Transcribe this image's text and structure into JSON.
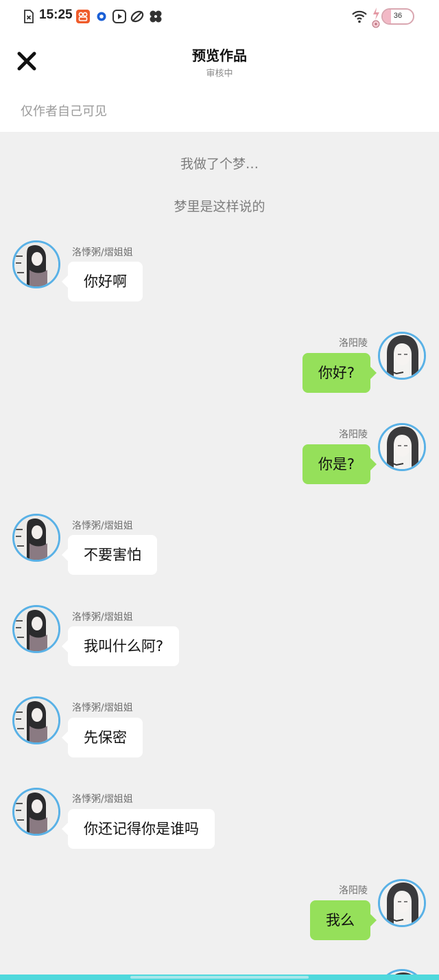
{
  "status_bar": {
    "time": "15:25",
    "battery_level": "36",
    "icons": [
      "sim-error-icon",
      "app-notification-icon",
      "circle-app-icon",
      "play-icon",
      "leaf-icon",
      "fan-icon",
      "wifi-icon",
      "charging-icon"
    ]
  },
  "header": {
    "title": "预览作品",
    "subtitle": "审核中",
    "visibility_note": "仅作者自己可见",
    "close_icon": "close-icon"
  },
  "narration": [
    "我做了个梦…",
    "梦里是这样说的"
  ],
  "messages": [
    {
      "side": "left",
      "speaker": "洛悸粥/熠姐姐",
      "text": "你好啊"
    },
    {
      "side": "right",
      "speaker": "洛阳陵",
      "text": "你好?"
    },
    {
      "side": "right",
      "speaker": "洛阳陵",
      "text": "你是?"
    },
    {
      "side": "left",
      "speaker": "洛悸粥/熠姐姐",
      "text": "不要害怕"
    },
    {
      "side": "left",
      "speaker": "洛悸粥/熠姐姐",
      "text": "我叫什么阿?"
    },
    {
      "side": "left",
      "speaker": "洛悸粥/熠姐姐",
      "text": "先保密"
    },
    {
      "side": "left",
      "speaker": "洛悸粥/熠姐姐",
      "text": "你还记得你是谁吗"
    },
    {
      "side": "right",
      "speaker": "洛阳陵",
      "text": "我么"
    }
  ],
  "colors": {
    "left_bubble": "#ffffff",
    "right_bubble": "#95e05a",
    "avatar_border": "#59b1e6",
    "chat_background": "#f0f0f0"
  }
}
